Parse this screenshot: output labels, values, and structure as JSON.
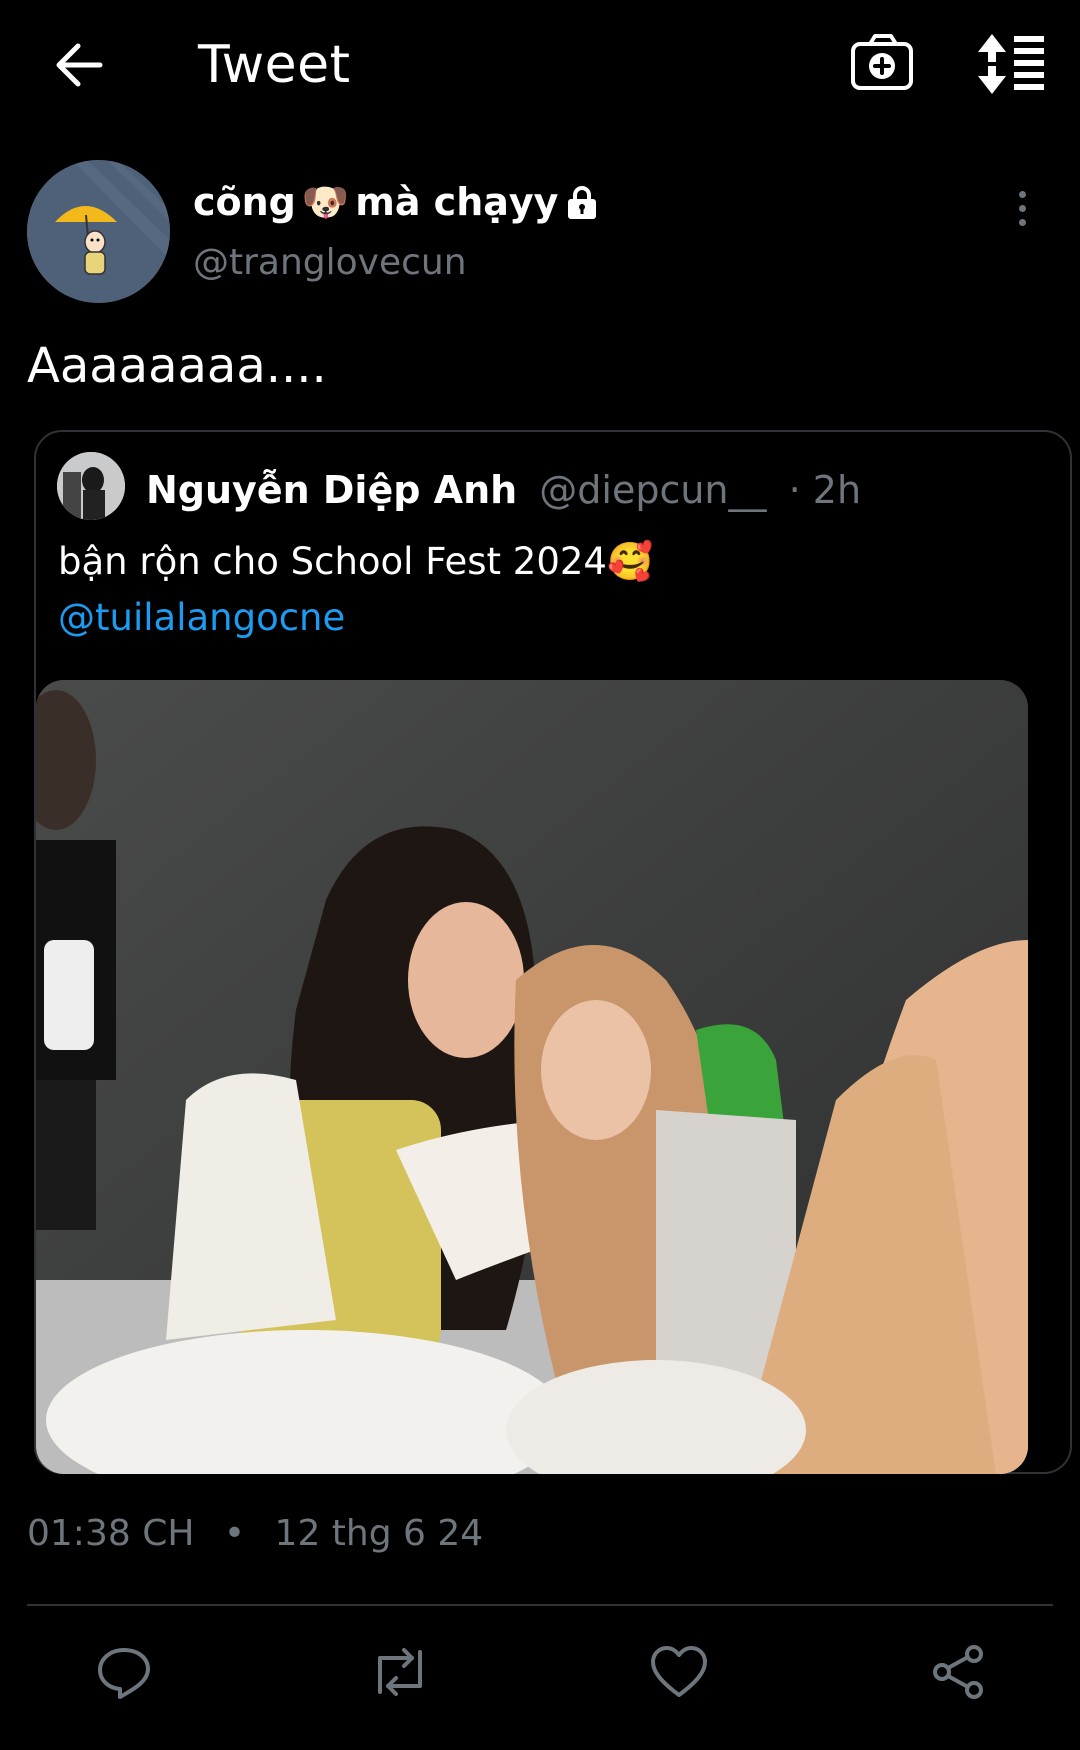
{
  "header": {
    "title": "Tweet",
    "back_icon": "arrow-left-icon",
    "camera_icon": "camera-plus-icon",
    "sort_icon": "sort-icon"
  },
  "author": {
    "display_name": "cõng",
    "display_name_2": "mà chạyy",
    "emoji": "🐶",
    "handle": "@tranglovecun",
    "locked_icon": "lock-icon"
  },
  "tweet": {
    "text": "Aaaaaaaa...."
  },
  "quoted": {
    "name": "Nguyễn Diệp Anh",
    "handle": "@diepcun__",
    "time": "· 2h",
    "text": "bận rộn cho School Fest 2024🥰",
    "mention": "@tuilalangocne"
  },
  "meta": {
    "time": "01:38 CH",
    "separator": "•",
    "date": "12 thg 6 24"
  },
  "actions": [
    "reply-icon",
    "retweet-icon",
    "like-icon",
    "share-icon"
  ],
  "colors": {
    "background": "#000000",
    "secondary_text": "#6e767d",
    "link": "#1d9bf0",
    "border": "#2f3336"
  }
}
